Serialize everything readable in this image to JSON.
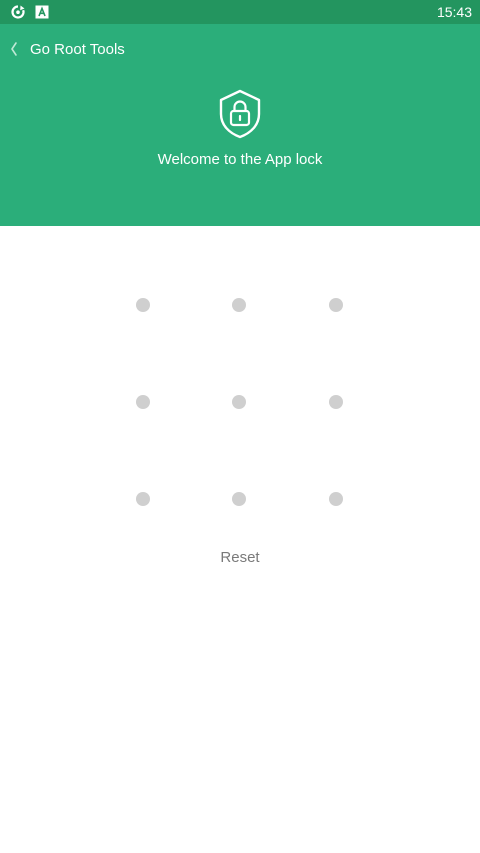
{
  "status_bar": {
    "time": "15:43",
    "icons": [
      "sync-notification-icon",
      "app-notification-icon"
    ]
  },
  "header": {
    "title": "Go Root Tools",
    "back_icon": "chevron-left-icon",
    "lock_icon": "shield-lock-icon",
    "welcome_text": "Welcome to the App lock",
    "background_color": "#2bae7a",
    "status_bar_color": "#23955f"
  },
  "pattern": {
    "rows": 3,
    "cols": 3,
    "dot_color": "#cfcfcf"
  },
  "actions": {
    "reset_label": "Reset"
  }
}
